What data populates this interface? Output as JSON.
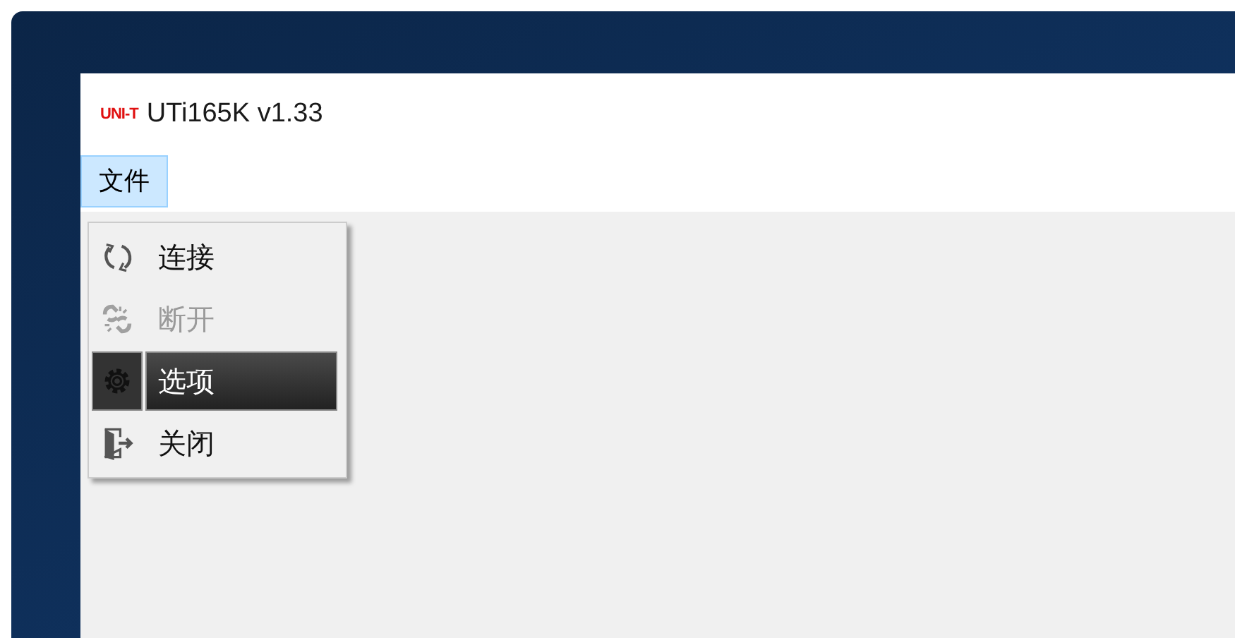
{
  "window": {
    "logo": "UNI-T",
    "title": "UTi165K v1.33"
  },
  "menu_bar": [
    {
      "label": "文件",
      "selected": true
    }
  ],
  "menu": [
    {
      "label": "连接",
      "kind": "connect",
      "disabled": false,
      "selected": false
    },
    {
      "label": "断开",
      "kind": "disconnect",
      "disabled": true,
      "selected": false
    },
    {
      "label": "选项",
      "kind": "options",
      "disabled": false,
      "selected": true
    },
    {
      "label": "关闭",
      "kind": "exit",
      "disabled": false,
      "selected": false
    }
  ]
}
